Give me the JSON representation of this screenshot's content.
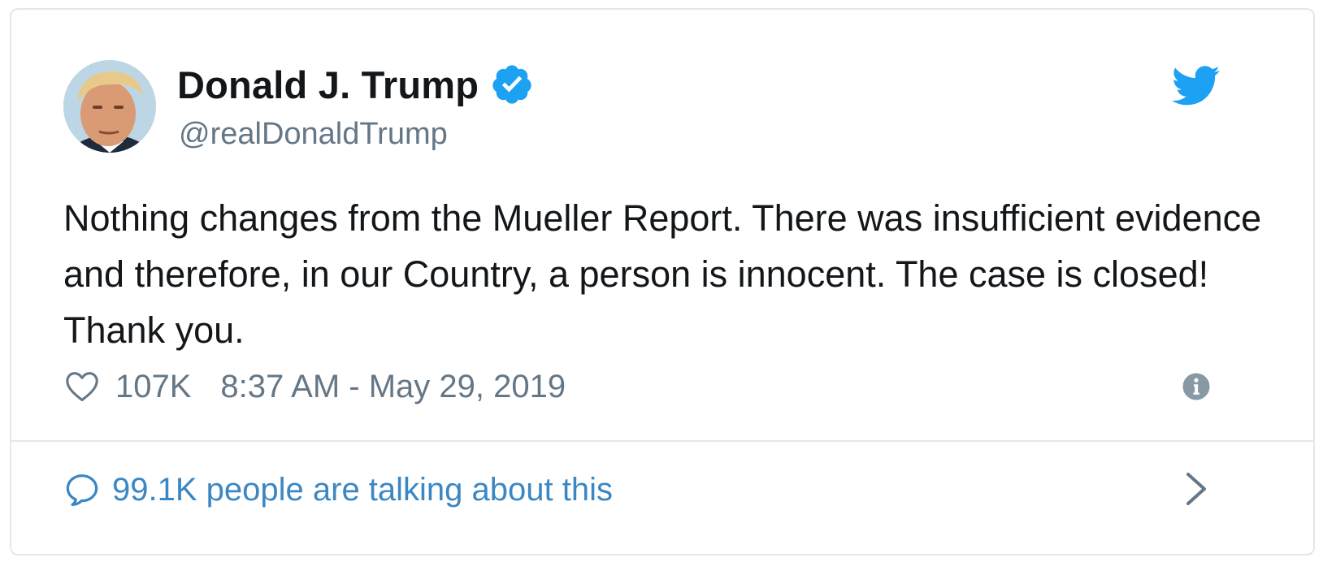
{
  "tweet": {
    "author_name": "Donald J. Trump",
    "handle": "@realDonaldTrump",
    "text": "Nothing changes from the Mueller Report. There was insufficient evidence and therefore, in our Country, a person is innocent. The case is closed! Thank you.",
    "like_count": "107K",
    "timestamp": "8:37 AM - May 29, 2019"
  },
  "conversation": {
    "label": "99.1K people are talking about this"
  },
  "icons": {
    "verified": "verified-badge-icon",
    "brand": "twitter-bird-icon",
    "like": "heart-icon",
    "info": "info-icon",
    "comment": "speech-bubble-icon",
    "more": "chevron-right-icon"
  },
  "colors": {
    "brand_blue": "#1da1f2",
    "link_blue": "#3b87c4",
    "secondary_text": "#657786",
    "primary_text": "#14171a",
    "border": "#e1e8ed"
  }
}
